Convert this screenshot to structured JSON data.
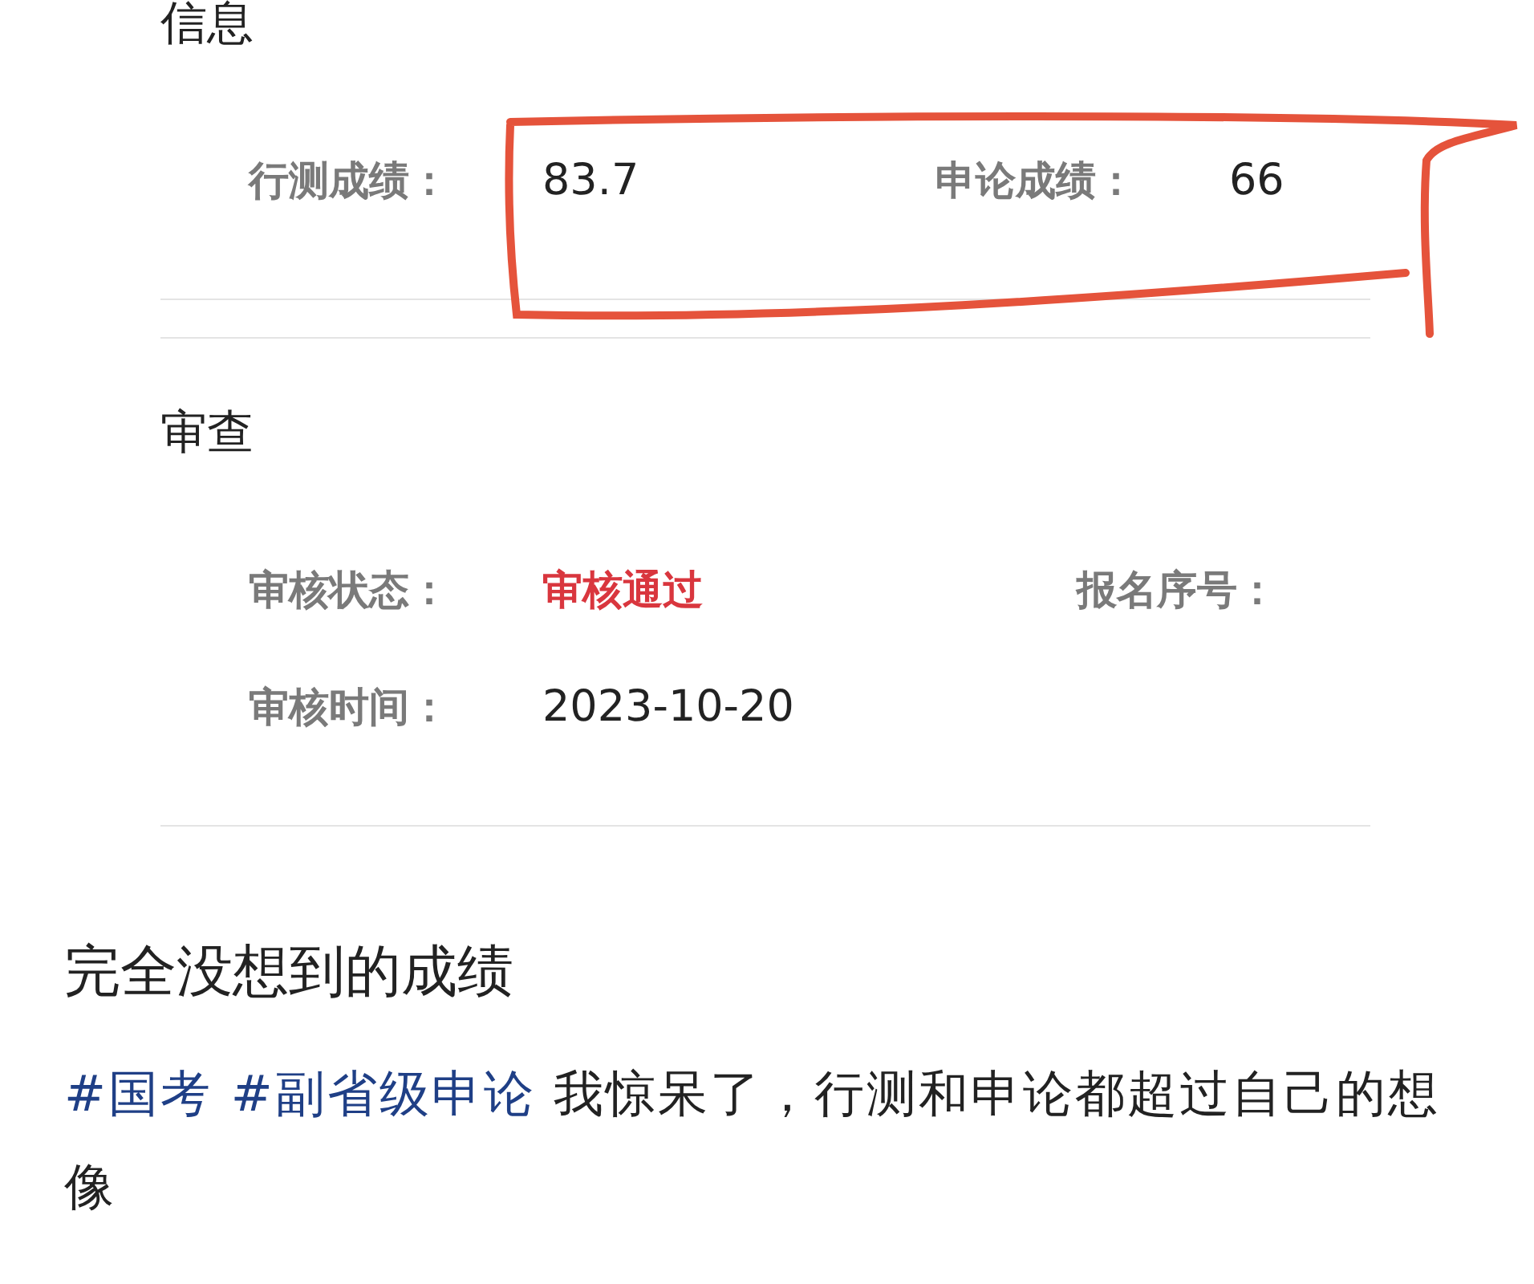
{
  "sections": [
    {
      "title": "信息",
      "rows": [
        [
          {
            "label": "行测成绩：",
            "value": "83.7"
          },
          {
            "label": "申论成绩：",
            "value": "66"
          }
        ]
      ]
    },
    {
      "title": "审查",
      "rows": [
        [
          {
            "label": "审核状态：",
            "value": "审核通过",
            "kind": "status"
          },
          {
            "label": "报名序号："
          }
        ],
        [
          {
            "label": "审核时间：",
            "value": "2023-10-20"
          }
        ]
      ]
    }
  ],
  "post": {
    "title": "完全没想到的成绩",
    "tags": [
      "#国考",
      "#副省级申论"
    ],
    "text": "我惊呆了，行测和申论都超过自己的想像"
  }
}
